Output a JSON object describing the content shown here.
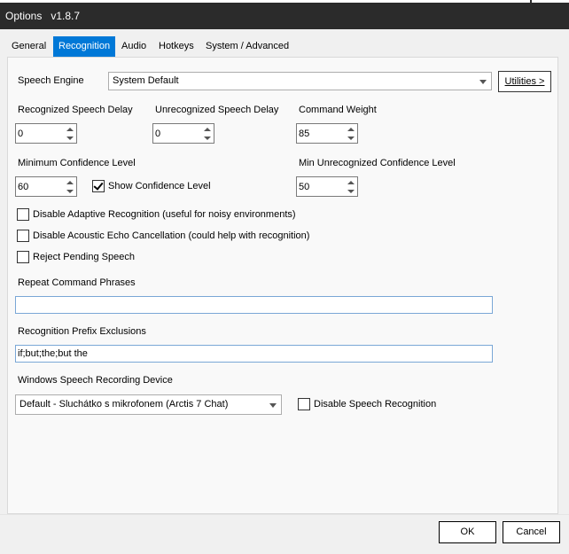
{
  "window": {
    "title": "Options",
    "version": "v1.8.7"
  },
  "tabs": [
    {
      "label": "General"
    },
    {
      "label": "Recognition"
    },
    {
      "label": "Audio"
    },
    {
      "label": "Hotkeys"
    },
    {
      "label": "System / Advanced"
    }
  ],
  "active_tab": "Recognition",
  "speech_engine": {
    "label": "Speech Engine",
    "value": "System Default",
    "utilities_label": "Utilities >"
  },
  "recognized_delay": {
    "label": "Recognized Speech Delay",
    "value": "0"
  },
  "unrecognized_delay": {
    "label": "Unrecognized Speech Delay",
    "value": "0"
  },
  "command_weight": {
    "label": "Command Weight",
    "value": "85"
  },
  "min_confidence": {
    "label": "Minimum Confidence Level",
    "value": "60"
  },
  "show_confidence": {
    "label": "Show Confidence Level",
    "checked": true
  },
  "min_unrecognized_confidence": {
    "label": "Min Unrecognized Confidence Level",
    "value": "50"
  },
  "options": [
    {
      "label": "Disable Adaptive Recognition (useful for noisy environments)",
      "checked": false
    },
    {
      "label": "Disable Acoustic Echo Cancellation (could help with recognition)",
      "checked": false
    },
    {
      "label": "Reject Pending Speech",
      "checked": false
    }
  ],
  "repeat_phrases": {
    "label": "Repeat Command Phrases",
    "value": ""
  },
  "prefix_exclusions": {
    "label": "Recognition Prefix Exclusions",
    "value": "if;but;the;but the"
  },
  "recording_device": {
    "label": "Windows Speech Recording Device",
    "value": "Default - Sluchátko s mikrofonem (Arctis 7 Chat)"
  },
  "disable_speech": {
    "label": "Disable Speech Recognition",
    "checked": false
  },
  "footer": {
    "ok_label": "OK",
    "cancel_label": "Cancel"
  }
}
